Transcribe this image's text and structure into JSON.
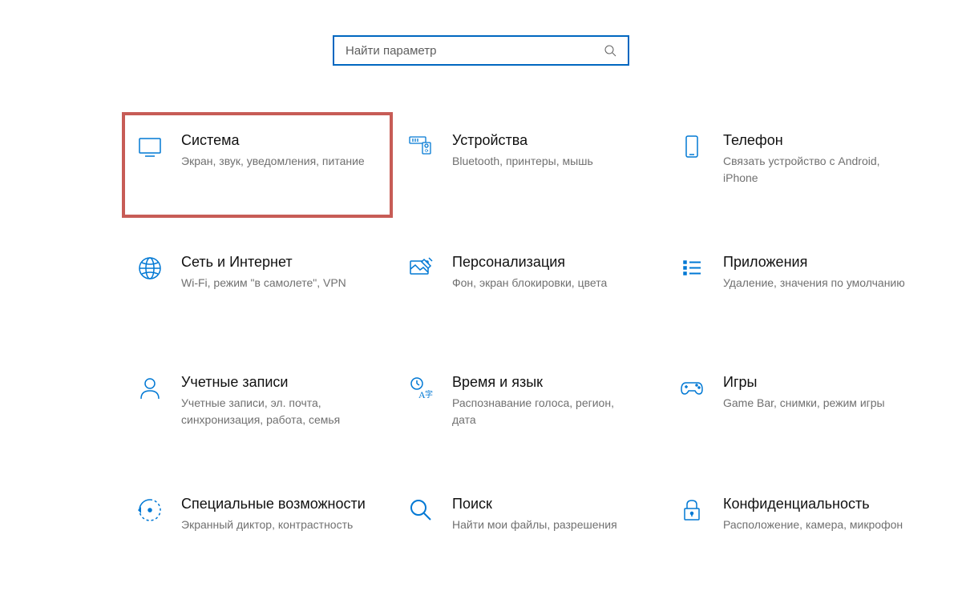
{
  "search": {
    "placeholder": "Найти параметр"
  },
  "categories": [
    {
      "title": "Система",
      "desc": "Экран, звук, уведомления, питание"
    },
    {
      "title": "Устройства",
      "desc": "Bluetooth, принтеры, мышь"
    },
    {
      "title": "Телефон",
      "desc": "Связать устройство с Android, iPhone"
    },
    {
      "title": "Сеть и Интернет",
      "desc": "Wi-Fi, режим \"в самолете\", VPN"
    },
    {
      "title": "Персонализация",
      "desc": "Фон, экран блокировки, цвета"
    },
    {
      "title": "Приложения",
      "desc": "Удаление, значения по умолчанию"
    },
    {
      "title": "Учетные записи",
      "desc": "Учетные записи, эл. почта, синхронизация, работа, семья"
    },
    {
      "title": "Время и язык",
      "desc": "Распознавание голоса, регион, дата"
    },
    {
      "title": "Игры",
      "desc": "Game Bar, снимки, режим игры"
    },
    {
      "title": "Специальные возможности",
      "desc": "Экранный диктор, контрастность"
    },
    {
      "title": "Поиск",
      "desc": "Найти мои файлы, разрешения"
    },
    {
      "title": "Конфиденциальность",
      "desc": "Расположение, камера, микрофон"
    }
  ],
  "colors": {
    "accent": "#0078d4",
    "highlight_border": "#c75c56"
  }
}
